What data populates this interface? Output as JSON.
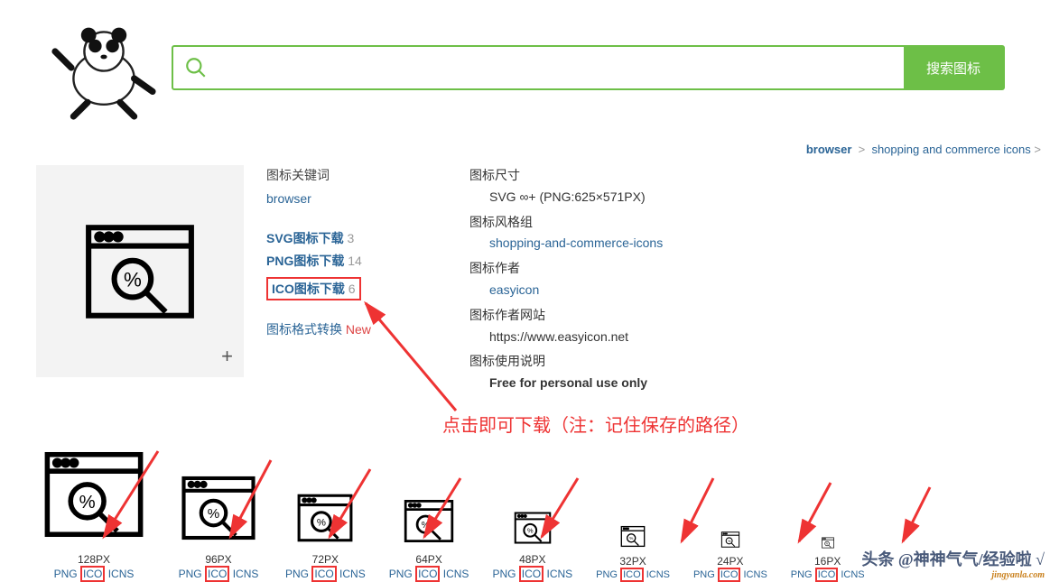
{
  "header": {
    "search_placeholder": "",
    "search_button": "搜索图标"
  },
  "breadcrumb": {
    "first": "browser",
    "sep": ">",
    "second": "shopping and commerce icons",
    "third": ">"
  },
  "left": {
    "keywords_label": "图标关键词",
    "keyword": "browser",
    "svg": {
      "label": "SVG图标下载",
      "count": "3"
    },
    "png": {
      "label": "PNG图标下载",
      "count": "14"
    },
    "ico": {
      "label": "ICO图标下载",
      "count": "6"
    },
    "convert": {
      "label": "图标格式转换",
      "badge": "New"
    }
  },
  "right": {
    "size_label": "图标尺寸",
    "size_value": "SVG ∞+ (PNG:625×571PX)",
    "style_label": "图标风格组",
    "style_value": "shopping-and-commerce-icons",
    "author_label": "图标作者",
    "author_value": "easyicon",
    "site_label": "图标作者网站",
    "site_value": "https://www.easyicon.net",
    "usage_label": "图标使用说明",
    "usage_value": "Free for personal use only"
  },
  "annotation": "点击即可下载（注：记住保存的路径）",
  "sizes": [
    {
      "px": "128PX",
      "fmts": [
        "PNG",
        "ICO",
        "ICNS"
      ],
      "dim": 128
    },
    {
      "px": "96PX",
      "fmts": [
        "PNG",
        "ICO",
        "ICNS"
      ],
      "dim": 96
    },
    {
      "px": "72PX",
      "fmts": [
        "PNG",
        "ICO",
        "ICNS"
      ],
      "dim": 72
    },
    {
      "px": "64PX",
      "fmts": [
        "PNG",
        "ICO",
        "ICNS"
      ],
      "dim": 64
    },
    {
      "px": "48PX",
      "fmts": [
        "PNG",
        "ICO",
        "ICNS"
      ],
      "dim": 48
    },
    {
      "px": "32PX",
      "fmts": [
        "PNG",
        "ICO",
        "ICNS"
      ],
      "dim": 32
    },
    {
      "px": "24PX",
      "fmts": [
        "PNG",
        "ICO",
        "ICNS"
      ],
      "dim": 24
    },
    {
      "px": "16PX",
      "fmts": [
        "PNG",
        "ICO",
        "ICNS"
      ],
      "dim": 16
    }
  ],
  "watermark": {
    "text": "头条 @神神气气/经验啦 √",
    "site": "jingyanla.com"
  }
}
